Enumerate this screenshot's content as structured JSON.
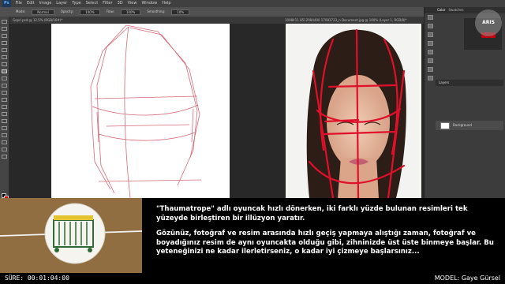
{
  "app": {
    "logo": "Ps",
    "menu": [
      "File",
      "Edit",
      "Image",
      "Layer",
      "Type",
      "Select",
      "Filter",
      "3D",
      "View",
      "Window",
      "Help"
    ]
  },
  "options_bar": {
    "mode_label": "Mode:",
    "mode_value": "Normal",
    "opacity_label": "Opacity:",
    "opacity_value": "100%",
    "flow_label": "Flow:",
    "flow_value": "100%",
    "smoothing_label": "Smoothing:",
    "smoothing_value": "10%"
  },
  "tabs": {
    "left_doc": "Gopri.psd @ 12.5% (RGB/16#)*",
    "right_doc": "1098411 8512984400 17081723_n Document.jpg @ 100% (Layer 1, RGB/8)*"
  },
  "panels": {
    "tabs": [
      "Color",
      "Swatches"
    ],
    "layers_label": "Layers",
    "layer_name": "Background"
  },
  "watermark": "ARIS",
  "caption": {
    "paragraph1": "\"Thaumatrope\" adlı oyuncak hızlı dönerken, iki farklı yüzde bulunan resimleri tek yüzeyde birleştiren bir illüzyon yaratır.",
    "paragraph2": "Gözünüz, fotoğraf ve resim arasında hızlı geçiş yapmaya alıştığı zaman, fotoğraf ve boyadığınız resim de aynı oyuncakta olduğu gibi, zihninizde üst üste binmeye başlar. Bu yeteneğinizi ne kadar ilerletirseniz, o kadar iyi çizmeye başlarsınız..."
  },
  "footer": {
    "timer_label": "SÜRE: 00:01:04:00",
    "model_label": "MODEL: Gaye Gürsel"
  },
  "colors": {
    "sketch": "#d05060",
    "foreground": "#000000",
    "background_swatch": "#d40000"
  }
}
